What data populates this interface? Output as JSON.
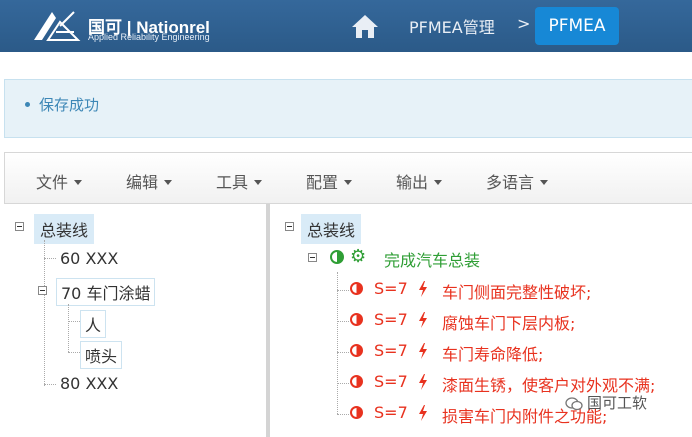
{
  "brand": {
    "name": "国可 | Nationrel",
    "tagline": "Applied Reliability Engineering"
  },
  "breadcrumb": {
    "home_icon": "home-icon",
    "parent": "PFMEA管理",
    "separator": ">",
    "current": "PFMEA"
  },
  "alert": {
    "message": "保存成功"
  },
  "menubar": {
    "items": [
      {
        "label": "文件"
      },
      {
        "label": "编辑"
      },
      {
        "label": "工具"
      },
      {
        "label": "配置"
      },
      {
        "label": "输出"
      },
      {
        "label": "多语言"
      }
    ]
  },
  "left_tree": {
    "root": "总装线",
    "children": [
      {
        "label": "60 XXX"
      },
      {
        "label": "70 车门涂蜡",
        "children": [
          {
            "label": "人"
          },
          {
            "label": "喷头"
          }
        ]
      },
      {
        "label": "80 XXX"
      }
    ]
  },
  "right_tree": {
    "root": "总装线",
    "function": "完成汽车总装",
    "failure_modes": [
      {
        "severity": "S=7",
        "text": "车门侧面完整性破坏;"
      },
      {
        "severity": "S=7",
        "text": "腐蚀车门下层内板;"
      },
      {
        "severity": "S=7",
        "text": "车门寿命降低;"
      },
      {
        "severity": "S=7",
        "text": "漆面生锈，使客户对外观不满;"
      },
      {
        "severity": "S=7",
        "text": "损害车门内附件之功能;"
      }
    ]
  },
  "watermark": "国可工软",
  "colors": {
    "header_bg": "#2f6090",
    "active_crumb": "#1788d6",
    "alert_text": "#3d87b6",
    "failure_red": "#e8321f",
    "function_green": "#2f9e35",
    "tree_highlight": "#d9ebf7"
  }
}
